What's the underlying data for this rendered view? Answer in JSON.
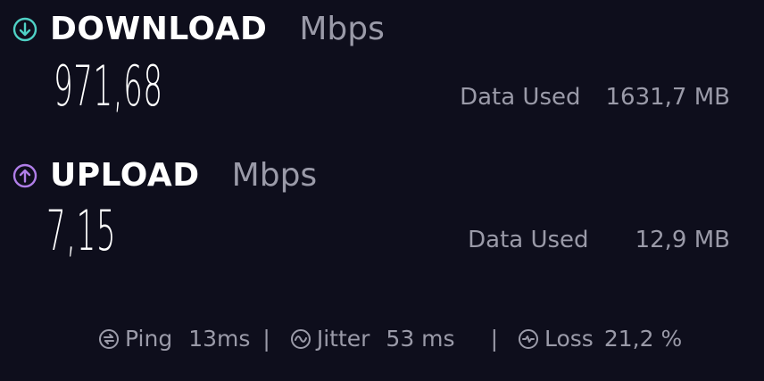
{
  "download": {
    "title": "DOWNLOAD",
    "unit": "Mbps",
    "value": "971,68",
    "data_used_label": "Data Used",
    "data_used_value": "1631,7 MB",
    "icon": "arrow-down-circle-icon",
    "accent": "#4fd1c5"
  },
  "upload": {
    "title": "UPLOAD",
    "unit": "Mbps",
    "value": "7,15",
    "data_used_label": "Data Used",
    "data_used_value": "12,9 MB",
    "icon": "arrow-up-circle-icon",
    "accent": "#b07ee8"
  },
  "stats": {
    "ping_label": "Ping",
    "ping_value": "13ms",
    "separator": "|",
    "jitter_label": "Jitter",
    "jitter_value": "53 ms",
    "loss_label": "Loss",
    "loss_value": "21,2 %"
  }
}
